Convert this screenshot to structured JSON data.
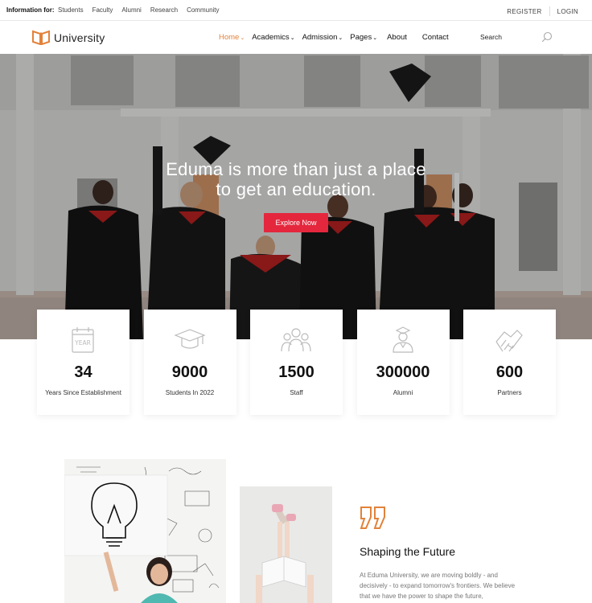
{
  "topbar": {
    "info_label": "Information for:",
    "links": [
      "Students",
      "Faculty",
      "Alumni",
      "Research",
      "Community"
    ],
    "register": "REGISTER",
    "login": "LOGIN"
  },
  "header": {
    "brand": "University",
    "nav": [
      {
        "label": "Home",
        "chevron": "⌄"
      },
      {
        "label": "Academics",
        "chevron": "⌄"
      },
      {
        "label": "Admission",
        "chevron": "⌄"
      },
      {
        "label": "Pages",
        "chevron": "⌄"
      },
      {
        "label": "About",
        "chevron": ""
      },
      {
        "label": "Contact",
        "chevron": ""
      }
    ],
    "search_label": "Search"
  },
  "hero": {
    "headline_line1": "Eduma is more than just a place",
    "headline_line2": "to get an education.",
    "cta": "Explore Now"
  },
  "stats": [
    {
      "icon": "calendar-year-icon",
      "value": "34",
      "label": "Years Since Establishment"
    },
    {
      "icon": "graduation-cap-icon",
      "value": "9000",
      "label": "Students In 2022"
    },
    {
      "icon": "staff-group-icon",
      "value": "1500",
      "label": "Staff"
    },
    {
      "icon": "graduate-person-icon",
      "value": "300000",
      "label": "Alumni"
    },
    {
      "icon": "handshake-icon",
      "value": "600",
      "label": "Partners"
    }
  ],
  "about": {
    "title": "Shaping the Future",
    "body": "At Eduma University, we are moving boldly - and decisively - to expand tomorrow's frontiers. We believe that we have the power to shape the future,"
  },
  "colors": {
    "accent": "#e2823a",
    "cta": "#e4273d",
    "text": "#222222",
    "muted": "#777777"
  }
}
